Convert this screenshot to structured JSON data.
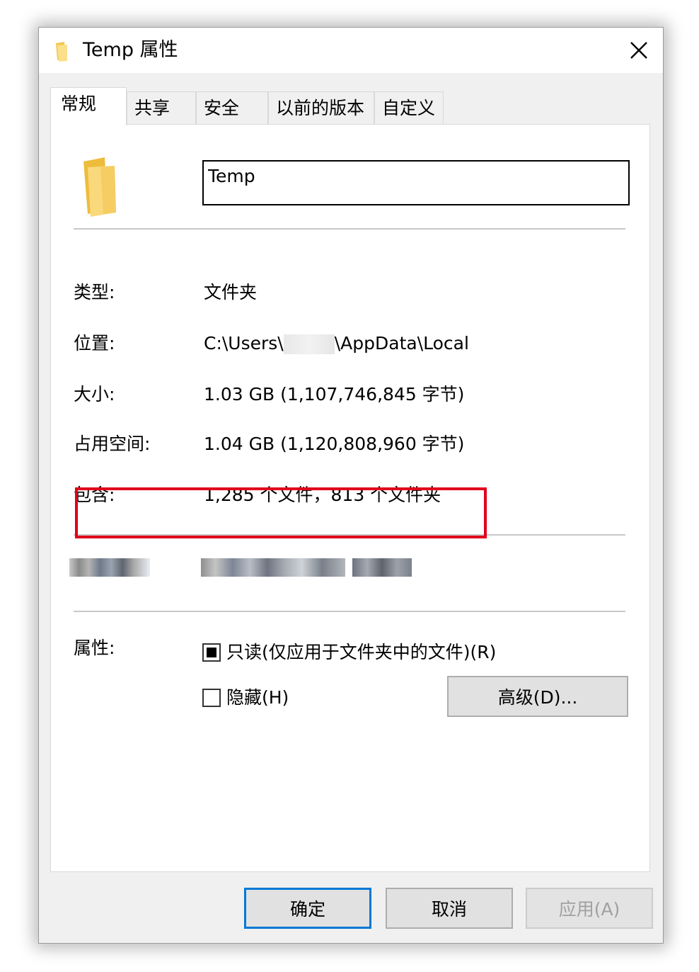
{
  "window": {
    "title": "Temp 属性",
    "close_glyph": "✕"
  },
  "tabs": [
    {
      "label": "常规",
      "active": true
    },
    {
      "label": "共享",
      "active": false
    },
    {
      "label": "安全",
      "active": false
    },
    {
      "label": "以前的版本",
      "active": false
    },
    {
      "label": "自定义",
      "active": false
    }
  ],
  "general": {
    "folder_name": "Temp",
    "type": {
      "label": "类型:",
      "value": "文件夹"
    },
    "location": {
      "label": "位置:",
      "value_prefix": "C:\\Users\\",
      "value_suffix": "\\AppData\\Local"
    },
    "size": {
      "label": "大小:",
      "value": "1.03 GB (1,107,746,845 字节)"
    },
    "size_on_disk": {
      "label": "占用空间:",
      "value": "1.04 GB (1,120,808,960 字节)"
    },
    "contains": {
      "label": "包含:",
      "value": "1,285 个文件，813 个文件夹"
    },
    "attributes": {
      "label": "属性:",
      "readonly": {
        "label": "只读(仅应用于文件夹中的文件)(R)",
        "state": "indeterminate"
      },
      "hidden": {
        "label": "隐藏(H)",
        "state": "unchecked"
      },
      "advanced_button": "高级(D)..."
    }
  },
  "footer": {
    "ok": "确定",
    "cancel": "取消",
    "apply": "应用(A)"
  },
  "colors": {
    "highlight": "#e0001b",
    "folder_yellow": "#f8d775",
    "default_button_border": "#0078d7"
  },
  "icons": {
    "title": "folder-icon",
    "large": "folder-icon",
    "close": "close-icon"
  }
}
